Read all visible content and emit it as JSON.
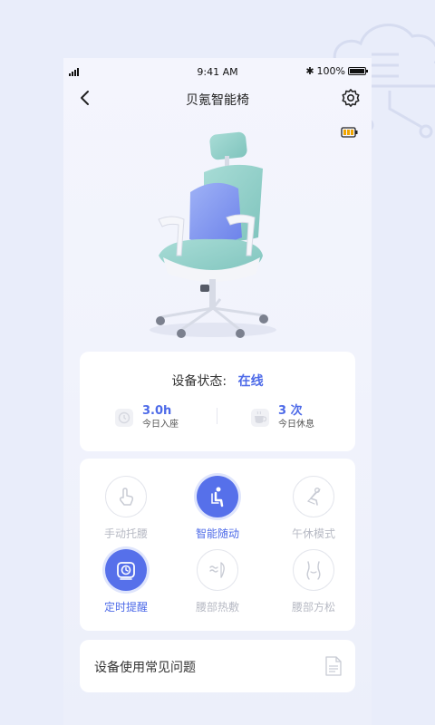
{
  "status_bar": {
    "time": "9:41 AM",
    "battery_percent": "100%"
  },
  "nav": {
    "title": "贝氪智能椅"
  },
  "device_status": {
    "label": "设备状态:",
    "value": "在线"
  },
  "stats": [
    {
      "value": "3.0h",
      "label": "今日入座"
    },
    {
      "value": "3 次",
      "label": "今日休息"
    }
  ],
  "modes": [
    {
      "label": "手动托腰",
      "icon": "hand-tap-icon",
      "active": false
    },
    {
      "label": "智能随动",
      "icon": "seated-person-icon",
      "active": true
    },
    {
      "label": "午休模式",
      "icon": "recline-person-icon",
      "active": false
    },
    {
      "label": "定时提醒",
      "icon": "timer-icon",
      "active": true
    },
    {
      "label": "腰部热敷",
      "icon": "heat-compress-icon",
      "active": false
    },
    {
      "label": "腰部方松",
      "icon": "waist-relax-icon",
      "active": false
    }
  ],
  "faq": {
    "label": "设备使用常见问题",
    "icon": "document-icon"
  },
  "colors": {
    "accent": "#4d6ae8",
    "accent_button": "#5670ea",
    "background": "#e9edfa",
    "muted": "#b7bac4"
  }
}
